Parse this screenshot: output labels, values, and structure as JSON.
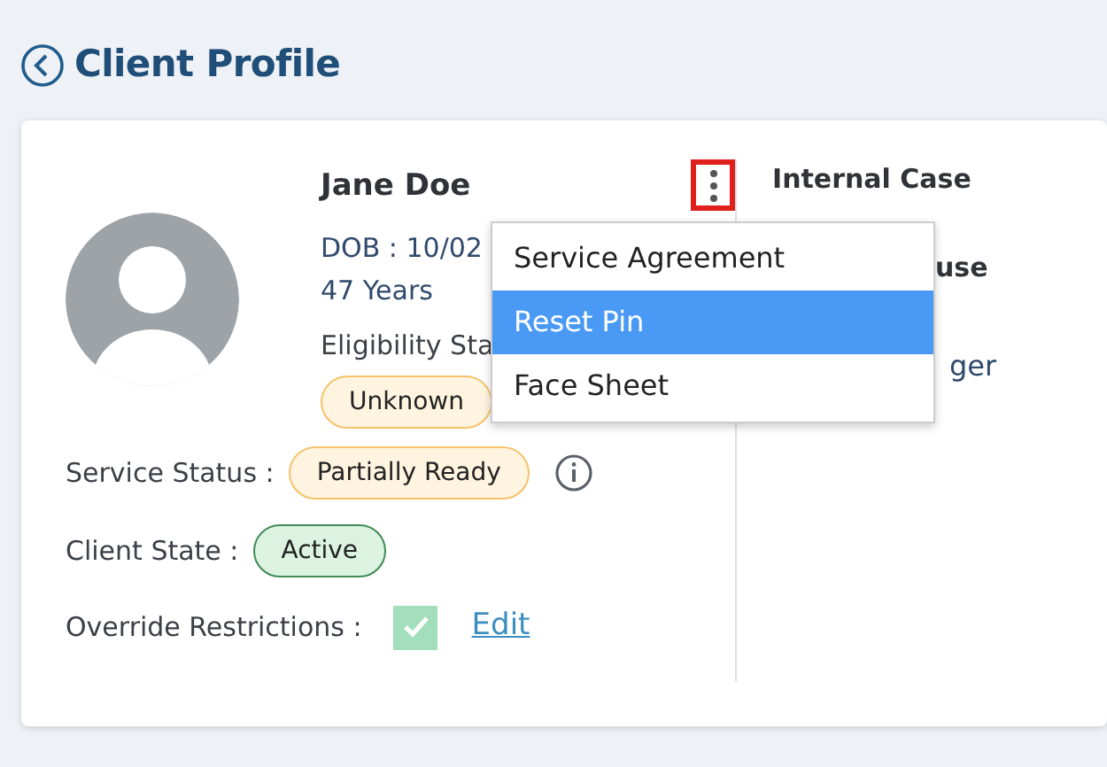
{
  "page_title": "Client Profile",
  "client": {
    "name": "Jane Doe",
    "dob": "DOB : 10/02",
    "age": "47 Years",
    "eligibility_label": "Eligibility Sta",
    "eligibility_status": "Unknown",
    "service_status_label": "Service Status :",
    "service_status": "Partially Ready",
    "client_state_label": "Client State :",
    "client_state": "Active",
    "override_label": "Override Restrictions :",
    "override_checked": true,
    "edit_link": "Edit"
  },
  "side_column": {
    "heading": "Internal Case",
    "line_2": "use",
    "line_3": "ger"
  },
  "menu": {
    "items": [
      {
        "label": "Service Agreement",
        "selected": false
      },
      {
        "label": "Reset Pin",
        "selected": true
      },
      {
        "label": "Face Sheet",
        "selected": false
      }
    ]
  }
}
